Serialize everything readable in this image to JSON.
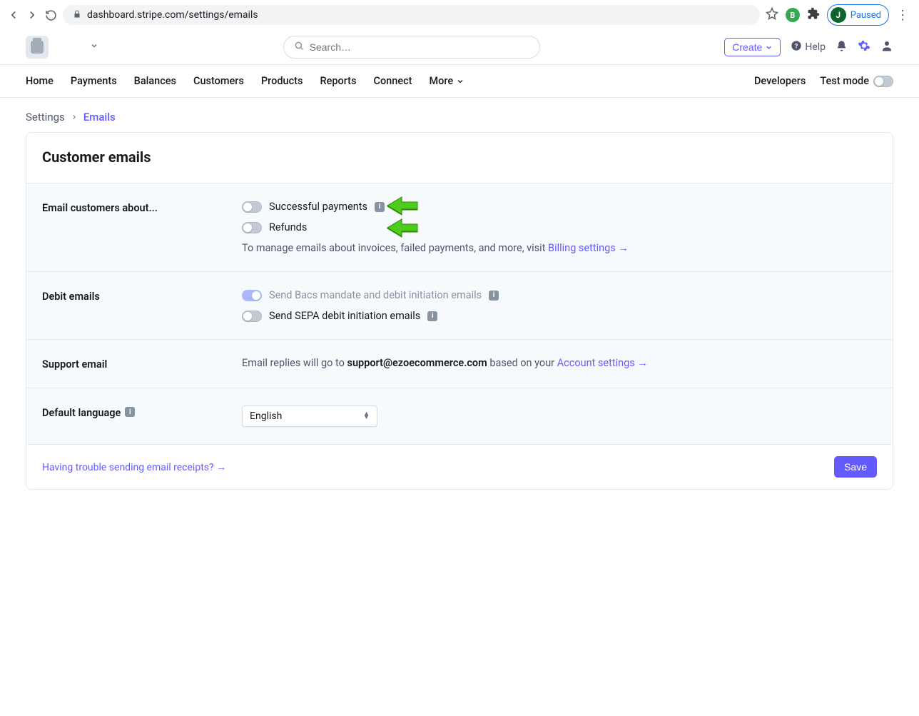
{
  "browser": {
    "url": "dashboard.stripe.com/settings/emails",
    "paused": "Paused",
    "avatar_initial": "J",
    "ext_b": "B"
  },
  "topbar": {
    "search_placeholder": "Search…",
    "create": "Create",
    "help": "Help"
  },
  "nav": {
    "home": "Home",
    "payments": "Payments",
    "balances": "Balances",
    "customers": "Customers",
    "products": "Products",
    "reports": "Reports",
    "connect": "Connect",
    "more": "More",
    "developers": "Developers",
    "test_mode": "Test mode"
  },
  "breadcrumb": {
    "root": "Settings",
    "current": "Emails"
  },
  "page": {
    "title": "Customer emails",
    "sections": {
      "email_customers": {
        "label": "Email customers about...",
        "successful": "Successful payments",
        "refunds": "Refunds",
        "hint_prefix": "To manage emails about invoices, failed payments, and more, visit ",
        "hint_link": "Billing settings"
      },
      "debit": {
        "label": "Debit emails",
        "bacs": "Send Bacs mandate and debit initiation emails",
        "sepa": "Send SEPA debit initiation emails"
      },
      "support": {
        "label": "Support email",
        "prefix": "Email replies will go to ",
        "email": "support@ezoecommerce.com",
        "suffix": " based on your ",
        "link": "Account settings"
      },
      "language": {
        "label": "Default language",
        "value": "English"
      }
    },
    "footer": {
      "trouble_link": "Having trouble sending email receipts?",
      "save": "Save"
    }
  }
}
